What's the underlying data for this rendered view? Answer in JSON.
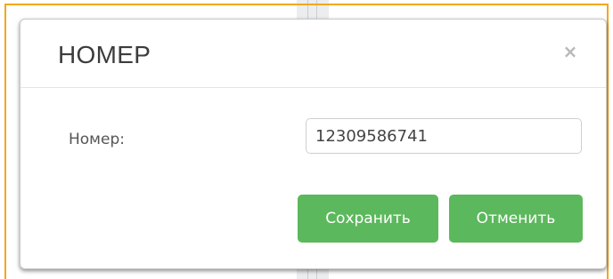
{
  "modal": {
    "title": "НОМЕР",
    "close_symbol": "×",
    "field": {
      "label": "Номер:",
      "value": "12309586741"
    },
    "buttons": {
      "save_label": "Сохранить",
      "cancel_label": "Отменить"
    }
  },
  "colors": {
    "primary_button": "#5cb85c",
    "frame_border": "#f2a81d"
  }
}
